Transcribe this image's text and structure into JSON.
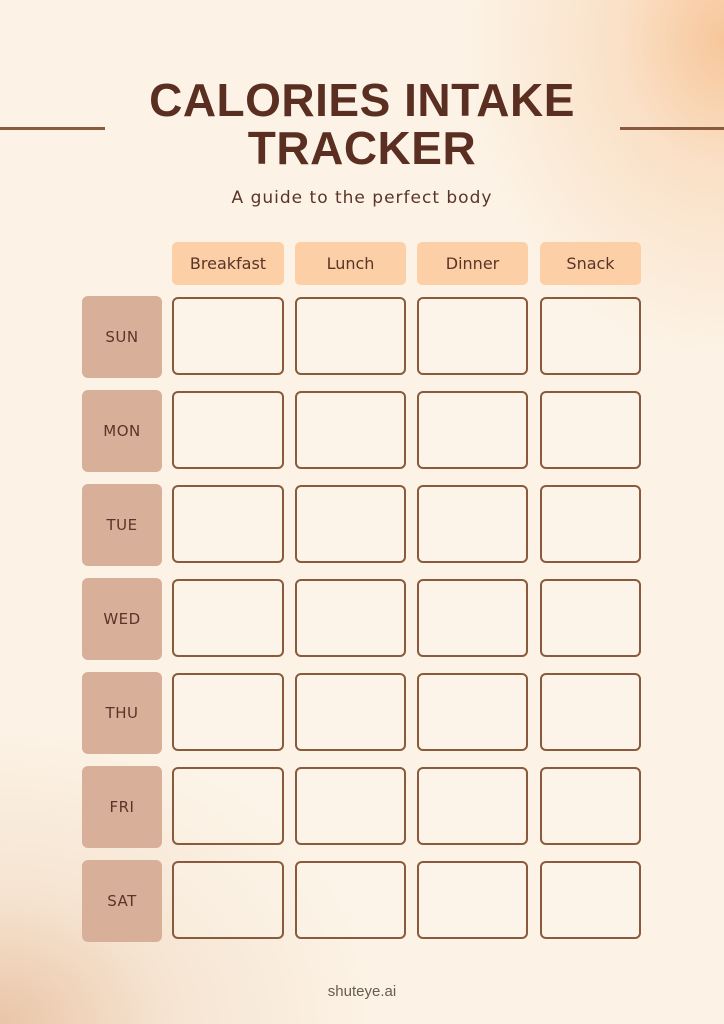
{
  "document": {
    "title_line1": "CALORIES INTAKE",
    "title_line2": "TRACKER",
    "subtitle": "A guide to the perfect body",
    "footer": "shuteye.ai",
    "colors": {
      "title": "#5a2e20",
      "rule": "#8a5a3c",
      "header_fill": "#fdcfa6",
      "day_fill": "#d8b09a",
      "cell_border": "#8a5a3c",
      "background": "#fcf3e6"
    }
  },
  "table": {
    "meals": [
      {
        "label": "Breakfast"
      },
      {
        "label": "Lunch"
      },
      {
        "label": "Dinner"
      },
      {
        "label": "Snack"
      }
    ],
    "days": [
      {
        "label": "SUN",
        "entries": [
          "",
          "",
          "",
          ""
        ]
      },
      {
        "label": "MON",
        "entries": [
          "",
          "",
          "",
          ""
        ]
      },
      {
        "label": "TUE",
        "entries": [
          "",
          "",
          "",
          ""
        ]
      },
      {
        "label": "WED",
        "entries": [
          "",
          "",
          "",
          ""
        ]
      },
      {
        "label": "THU",
        "entries": [
          "",
          "",
          "",
          ""
        ]
      },
      {
        "label": "FRI",
        "entries": [
          "",
          "",
          "",
          ""
        ]
      },
      {
        "label": "SAT",
        "entries": [
          "",
          "",
          "",
          ""
        ]
      }
    ]
  }
}
